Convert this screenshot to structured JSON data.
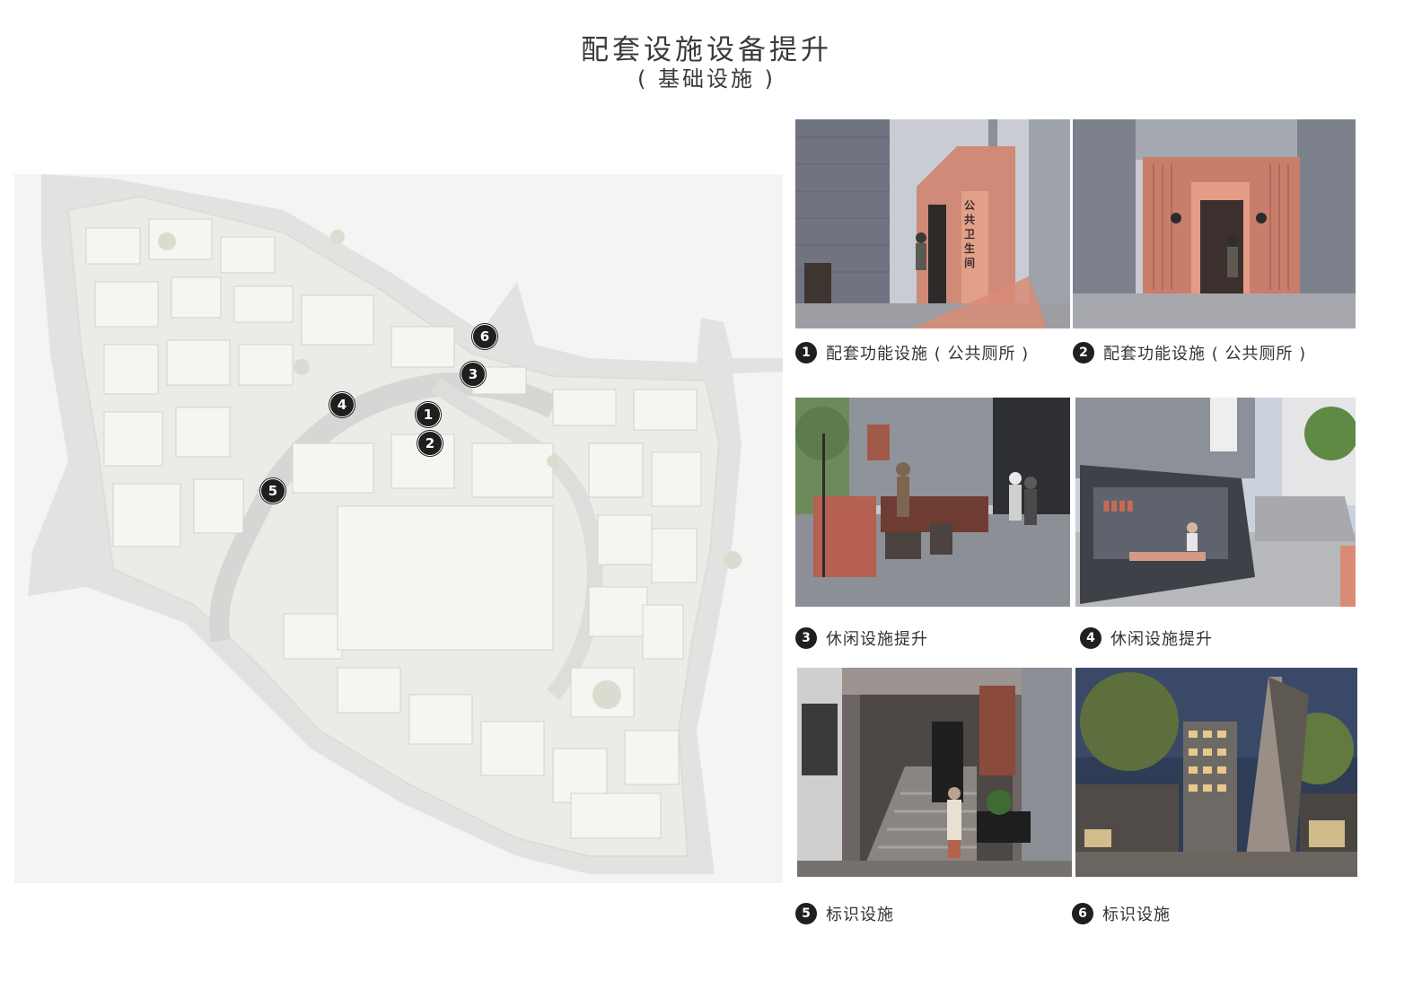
{
  "header": {
    "title": "配套设施设备提升",
    "subtitle": "( 基础设施 )"
  },
  "map": {
    "markers": [
      {
        "number": "1"
      },
      {
        "number": "2"
      },
      {
        "number": "3"
      },
      {
        "number": "4"
      },
      {
        "number": "5"
      },
      {
        "number": "6"
      }
    ]
  },
  "photos": [
    {
      "number": "1",
      "caption": "配套功能设施 ( 公共厕所 )",
      "sign_text": "公共卫生间",
      "accent": "#d98b76"
    },
    {
      "number": "2",
      "caption": "配套功能设施 ( 公共厕所 )",
      "accent": "#c9806e"
    },
    {
      "number": "3",
      "caption": "休闲设施提升",
      "accent": "#b5614f"
    },
    {
      "number": "4",
      "caption": "休闲设施提升",
      "accent": "#d48c7a"
    },
    {
      "number": "5",
      "caption": "标识设施",
      "accent": "#8a5a4a"
    },
    {
      "number": "6",
      "caption": "标识设施",
      "accent": "#2f3c56"
    }
  ]
}
